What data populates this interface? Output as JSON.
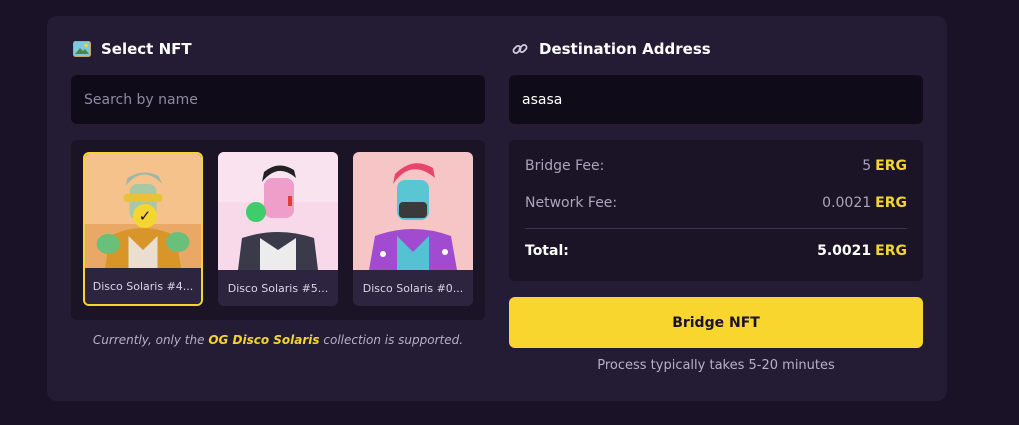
{
  "select_nft": {
    "title": "Select NFT",
    "icon": "image-icon"
  },
  "destination": {
    "title": "Destination Address",
    "icon": "link-icon",
    "value": "asasa"
  },
  "search": {
    "placeholder": "Search by name"
  },
  "nfts": [
    {
      "name": "Disco Solaris #4...",
      "selected": true
    },
    {
      "name": "Disco Solaris #5...",
      "selected": false
    },
    {
      "name": "Disco Solaris #0...",
      "selected": false
    }
  ],
  "note": {
    "prefix": "Currently, only the ",
    "highlight": "OG Disco Solaris",
    "suffix": " collection is supported."
  },
  "fees": {
    "bridge_label": "Bridge Fee:",
    "bridge_value": "5",
    "bridge_unit": "ERG",
    "network_label": "Network Fee:",
    "network_value": "0.0021",
    "network_unit": "ERG",
    "total_label": "Total:",
    "total_value": "5.0021",
    "total_unit": "ERG"
  },
  "button": {
    "label": "Bridge NFT"
  },
  "process_text": "Process typically takes 5-20 minutes",
  "colors": {
    "accent": "#f9d62e",
    "panel": "#241b35",
    "background": "#1a1227"
  }
}
